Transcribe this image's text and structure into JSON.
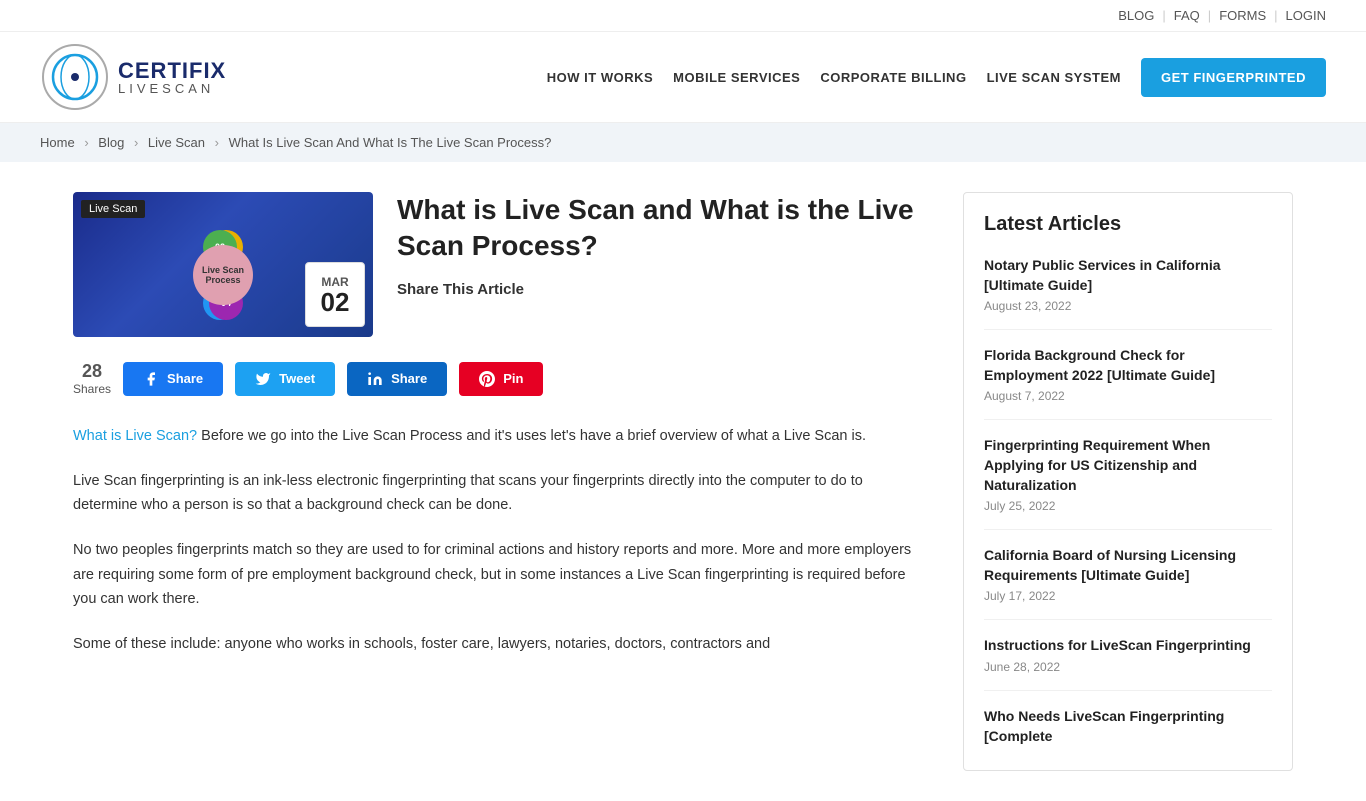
{
  "topbar": {
    "blog": "BLOG",
    "faq": "FAQ",
    "forms": "FORMS",
    "login": "LOGIN"
  },
  "header": {
    "logo_main": "CERTIFIX",
    "logo_sub": "LIVESCAN",
    "nav": {
      "how": "HOW IT WORKS",
      "mobile": "MOBILE SERVICES",
      "corporate": "CORPORATE BILLING",
      "livescan": "LIVE SCAN SYSTEM"
    },
    "cta": "GET FINGERPRINTED"
  },
  "breadcrumb": {
    "home": "Home",
    "blog": "Blog",
    "livescan": "Live Scan",
    "current": "What Is Live Scan And What Is The Live Scan Process?"
  },
  "hero": {
    "label": "Live Scan",
    "date_month": "MAR",
    "date_day": "02",
    "center_label": "Live Scan\nProcess",
    "orbit": [
      "01",
      "02",
      "03",
      "04"
    ]
  },
  "article": {
    "title": "What is Live Scan and What is the Live Scan Process?",
    "share_label": "Share This Article",
    "share_count": "28",
    "shares_text": "Shares",
    "buttons": {
      "share_facebook": "Share",
      "tweet": "Tweet",
      "share_linkedin": "Share",
      "pin": "Pin"
    },
    "body": {
      "para1_link": "What is Live Scan?",
      "para1": " Before we go into the Live Scan Process and it's uses let's have a brief overview of what a Live Scan is.",
      "para2": "Live Scan fingerprinting is an ink-less electronic fingerprinting that scans your fingerprints directly into the computer to do to determine who a person is so that a background check can be done.",
      "para3": "No two peoples fingerprints match so they are used to for criminal actions and history reports and more. More and more employers are requiring some form of pre employment background check, but in some instances a Live Scan fingerprinting is required before you can work there.",
      "para4": "Some of these include: anyone who works in schools, foster care, lawyers, notaries, doctors, contractors and"
    }
  },
  "sidebar": {
    "title": "Latest Articles",
    "articles": [
      {
        "title": "Notary Public Services in California [Ultimate Guide]",
        "date": "August 23, 2022"
      },
      {
        "title": "Florida Background Check for Employment 2022 [Ultimate Guide]",
        "date": "August 7, 2022"
      },
      {
        "title": "Fingerprinting Requirement When Applying for US Citizenship and Naturalization",
        "date": "July 25, 2022"
      },
      {
        "title": "California Board of Nursing Licensing Requirements [Ultimate Guide]",
        "date": "July 17, 2022"
      },
      {
        "title": "Instructions for LiveScan Fingerprinting",
        "date": "June 28, 2022"
      },
      {
        "title": "Who Needs LiveScan Fingerprinting [Complete",
        "date": ""
      }
    ]
  }
}
